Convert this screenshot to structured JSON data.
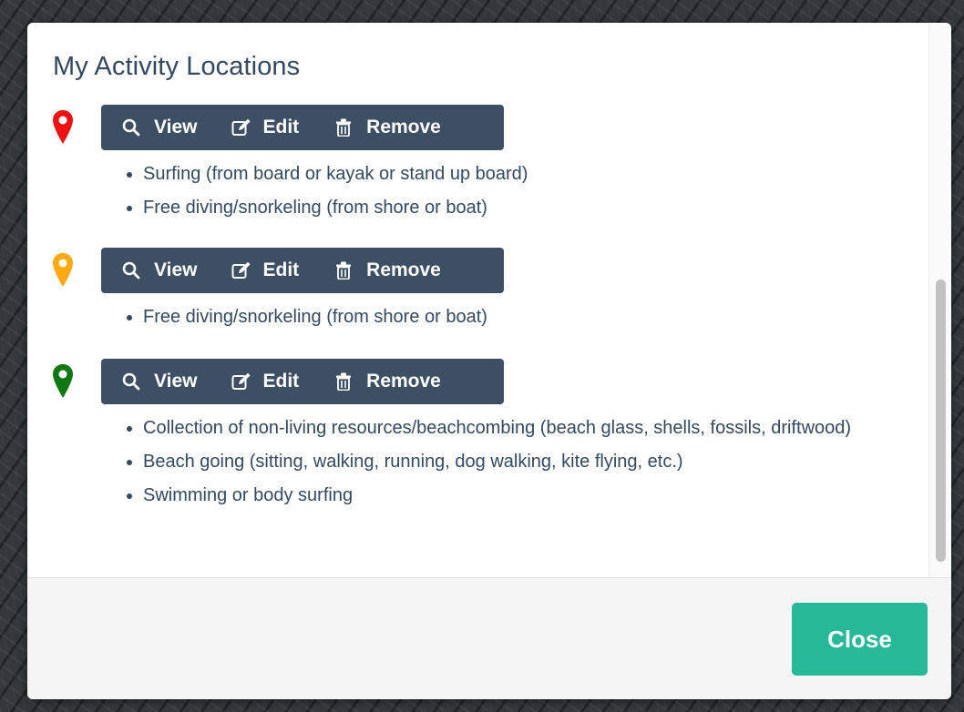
{
  "dialog": {
    "title": "My Activity Locations",
    "close_label": "Close"
  },
  "actions": {
    "view_label": "View",
    "edit_label": "Edit",
    "remove_label": "Remove"
  },
  "colors": {
    "pin_red": "#ee1111",
    "pin_orange": "#ffaa11",
    "pin_green": "#117711",
    "button_group": "#3c4f63",
    "close_button": "#26b997",
    "text": "#34495e"
  },
  "locations": [
    {
      "pin_icon": "map-marker-icon",
      "pin_color": "red",
      "activities": [
        "Surfing (from board or kayak or stand up board)",
        "Free diving/snorkeling (from shore or boat)"
      ]
    },
    {
      "pin_icon": "map-marker-icon",
      "pin_color": "orange",
      "activities": [
        "Free diving/snorkeling (from shore or boat)"
      ]
    },
    {
      "pin_icon": "map-marker-icon",
      "pin_color": "green",
      "activities": [
        "Collection of non-living resources/beachcombing (beach glass, shells, fossils, driftwood)",
        "Beach going (sitting, walking, running, dog walking, kite flying, etc.)",
        "Swimming or body surfing"
      ]
    }
  ]
}
